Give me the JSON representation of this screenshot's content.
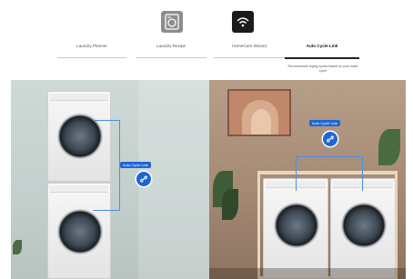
{
  "header": {
    "icon_left": {
      "icon": "washer-icon"
    },
    "icon_right": {
      "icon": "wifi-icon"
    }
  },
  "tabs": [
    {
      "label": "Laundry Planner",
      "active": false
    },
    {
      "label": "Laundry Recipe",
      "active": false
    },
    {
      "label": "HomeCare Wizard",
      "active": false
    },
    {
      "label": "Auto Cycle Link",
      "active": true
    }
  ],
  "active_tab_description": "Recommends drying cycles based on your wash cycle",
  "scenes": {
    "left": {
      "link_label": "Auto Cycle Link"
    },
    "right": {
      "link_label": "Auto Cycle Link"
    }
  },
  "colors": {
    "accent": "#1e66d6",
    "link_line": "#4a8ee8"
  }
}
